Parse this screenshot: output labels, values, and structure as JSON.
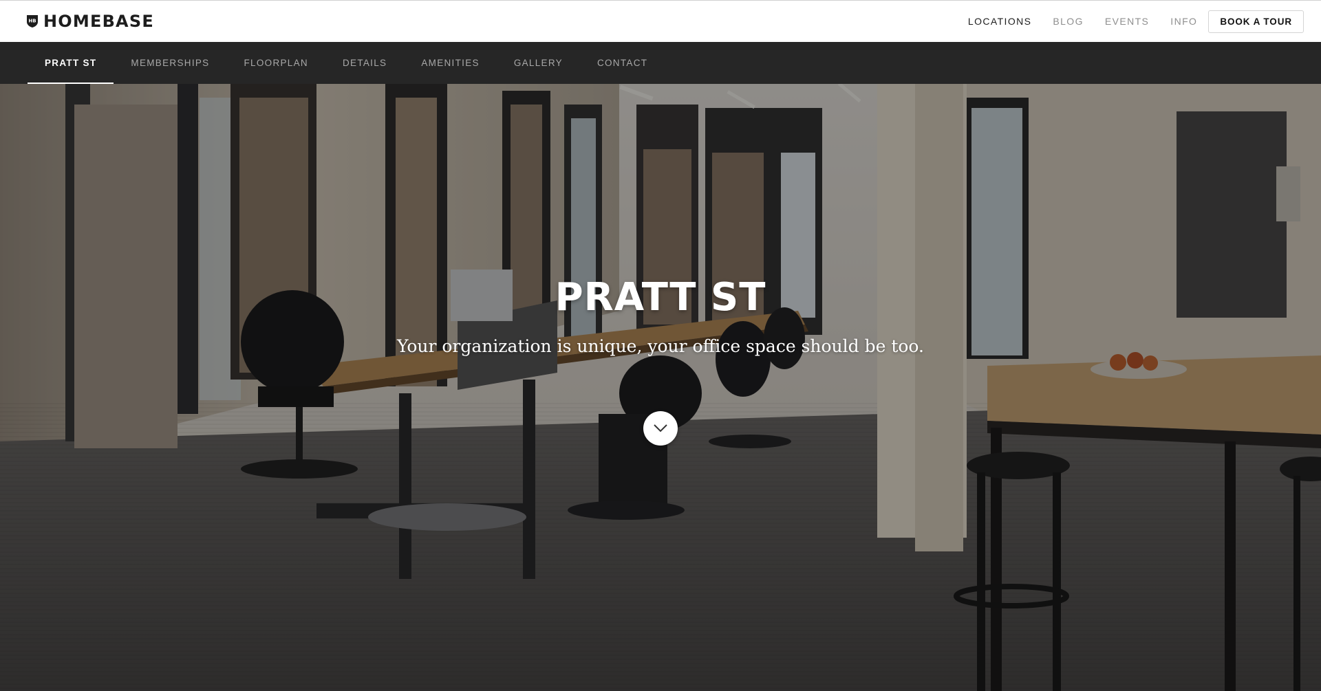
{
  "brand": {
    "name": "HOMEBASE",
    "mark_text": "HB"
  },
  "topnav": {
    "items": [
      {
        "label": "LOCATIONS",
        "active": true
      },
      {
        "label": "BLOG",
        "active": false
      },
      {
        "label": "EVENTS",
        "active": false
      },
      {
        "label": "INFO",
        "active": false
      }
    ],
    "cta_label": "BOOK A TOUR"
  },
  "subnav": {
    "items": [
      {
        "label": "PRATT ST",
        "active": true
      },
      {
        "label": "MEMBERSHIPS",
        "active": false
      },
      {
        "label": "FLOORPLAN",
        "active": false
      },
      {
        "label": "DETAILS",
        "active": false
      },
      {
        "label": "AMENITIES",
        "active": false
      },
      {
        "label": "GALLERY",
        "active": false
      },
      {
        "label": "CONTACT",
        "active": false
      }
    ]
  },
  "hero": {
    "title": "PRATT ST",
    "subtitle": "Your organization is unique, your office space should be too.",
    "scroll_icon": "chevron-down-icon"
  },
  "colors": {
    "topbar_bg": "#ffffff",
    "subnav_bg": "#262626",
    "text_dark": "#1d1d1d",
    "text_muted": "#8e8e8e"
  }
}
